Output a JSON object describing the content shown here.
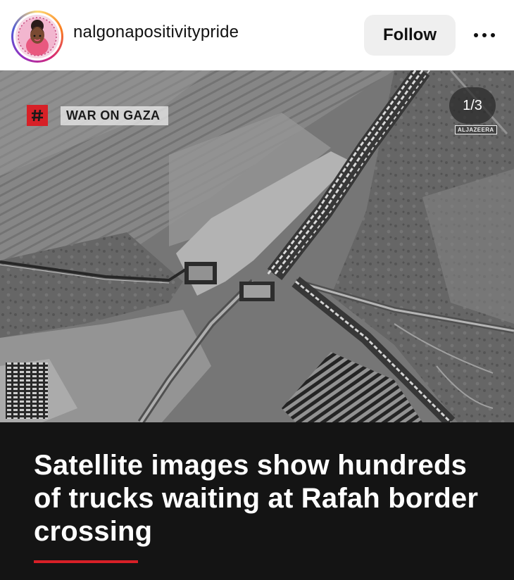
{
  "header": {
    "username": "nalgonapositivitypride",
    "follow_label": "Follow",
    "more_icon": "more-horizontal-icon"
  },
  "post": {
    "tag_icon": "hashtag-icon",
    "tag_label": "WAR ON GAZA",
    "counter": "1/3",
    "brand_logo": "ALJAZEERA",
    "headline": "Satellite images show hundreds of trucks waiting at Rafah border crossing"
  },
  "colors": {
    "accent_red": "#d72027",
    "follow_bg": "#efefef",
    "panel_bg": "#141414"
  }
}
